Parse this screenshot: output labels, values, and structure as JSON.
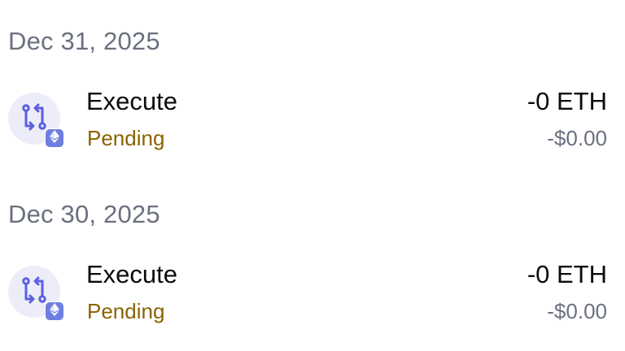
{
  "groups": [
    {
      "date": "Dec 31, 2025",
      "transactions": [
        {
          "title": "Execute",
          "status": "Pending",
          "amount": "-0 ETH",
          "fiat": "-$0.00",
          "icon": "execute-icon",
          "badge_icon": "ethereum-icon"
        }
      ]
    },
    {
      "date": "Dec 30, 2025",
      "transactions": [
        {
          "title": "Execute",
          "status": "Pending",
          "amount": "-0 ETH",
          "fiat": "-$0.00",
          "icon": "execute-icon",
          "badge_icon": "ethereum-icon"
        }
      ]
    }
  ],
  "colors": {
    "date": "#6b7080",
    "title": "#0b0b0f",
    "pending": "#8a6200",
    "fiat": "#6b7080",
    "icon_accent": "#5b5fe0",
    "avatar_bg": "#ecedf9",
    "badge_bg": "#6d7fe0"
  }
}
